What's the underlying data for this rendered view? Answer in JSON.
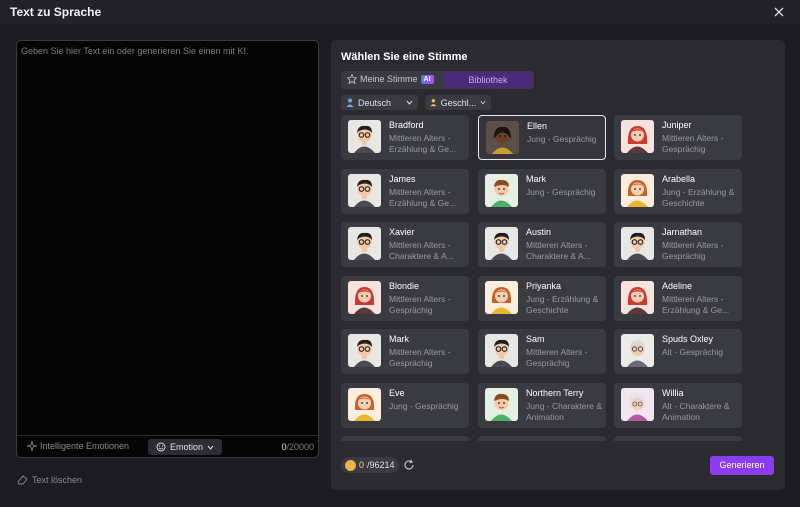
{
  "window": {
    "title": "Text zu Sprache"
  },
  "editor": {
    "placeholder": "Geben Sie hier Text ein oder generieren Sie einen mit KI.",
    "smart_emotions_label": "Intelligente Emotionen",
    "emotion_label": "Emotion",
    "char_count": "0",
    "char_limit": "/20000"
  },
  "clear_text_label": "Text löschen",
  "panel": {
    "title": "Wählen Sie eine Stimme",
    "tab_mine": "Meine Stimme",
    "ai_badge": "AI",
    "tab_library": "Bibliothek",
    "filter_language": "Deutsch",
    "filter_gender": "Geschl..."
  },
  "voices": [
    {
      "name": "Bradford",
      "desc": "Mittleren Alters - Erzählung & Ge...",
      "avatar": "man-glasses",
      "selected": false
    },
    {
      "name": "Ellen",
      "desc": "Jung - Gesprächig",
      "avatar": "woman-dark",
      "selected": true
    },
    {
      "name": "Juniper",
      "desc": "Mittleren Alters - Gesprächig",
      "avatar": "woman-red",
      "selected": false
    },
    {
      "name": "James",
      "desc": "Mittleren Alters - Erzählung & Ge...",
      "avatar": "man-glasses",
      "selected": false
    },
    {
      "name": "Mark",
      "desc": "Jung - Gesprächig",
      "avatar": "boy-green",
      "selected": false
    },
    {
      "name": "Arabella",
      "desc": "Jung - Erzählung & Geschichte",
      "avatar": "girl-yellow",
      "selected": false
    },
    {
      "name": "Xavier",
      "desc": "Mittleren Alters - Charaktere & A...",
      "avatar": "man-glasses",
      "selected": false
    },
    {
      "name": "Austin",
      "desc": "Mittleren Alters - Charaktere & A...",
      "avatar": "man-glasses",
      "selected": false
    },
    {
      "name": "Jarnathan",
      "desc": "Mittleren Alters - Gesprächig",
      "avatar": "man-glasses",
      "selected": false
    },
    {
      "name": "Blondie",
      "desc": "Mittleren Alters - Gesprächig",
      "avatar": "woman-red",
      "selected": false
    },
    {
      "name": "Priyanka",
      "desc": "Jung - Erzählung & Geschichte",
      "avatar": "girl-yellow",
      "selected": false
    },
    {
      "name": "Adeline",
      "desc": "Mittleren Alters - Erzählung & Ge...",
      "avatar": "woman-red",
      "selected": false
    },
    {
      "name": "Mark",
      "desc": "Mittleren Alters - Gesprächig",
      "avatar": "man-glasses",
      "selected": false
    },
    {
      "name": "Sam",
      "desc": "Mittleren Alters - Gesprächig",
      "avatar": "man-glasses",
      "selected": false
    },
    {
      "name": "Spuds Oxley",
      "desc": "Alt - Gesprächig",
      "avatar": "old-man",
      "selected": false
    },
    {
      "name": "Eve",
      "desc": "Jung - Gesprächig",
      "avatar": "girl-yellow",
      "selected": false
    },
    {
      "name": "Northern Terry",
      "desc": "Jung - Charaktere & Animation",
      "avatar": "boy-green",
      "selected": false
    },
    {
      "name": "Willia",
      "desc": "Alt - Charaktere & Animation",
      "avatar": "old-woman",
      "selected": false
    },
    {
      "name": "",
      "desc": "",
      "avatar": "",
      "selected": false
    },
    {
      "name": "",
      "desc": "",
      "avatar": "",
      "selected": false
    },
    {
      "name": "",
      "desc": "",
      "avatar": "",
      "selected": false
    }
  ],
  "footer": {
    "credits_used": "0",
    "credits_total": "/96214",
    "generate_label": "Generieren"
  },
  "colors": {
    "accent": "#8a3cf0",
    "background": "#1c1c1f",
    "panel": "#2a2a2f",
    "card": "#3a3a41"
  }
}
